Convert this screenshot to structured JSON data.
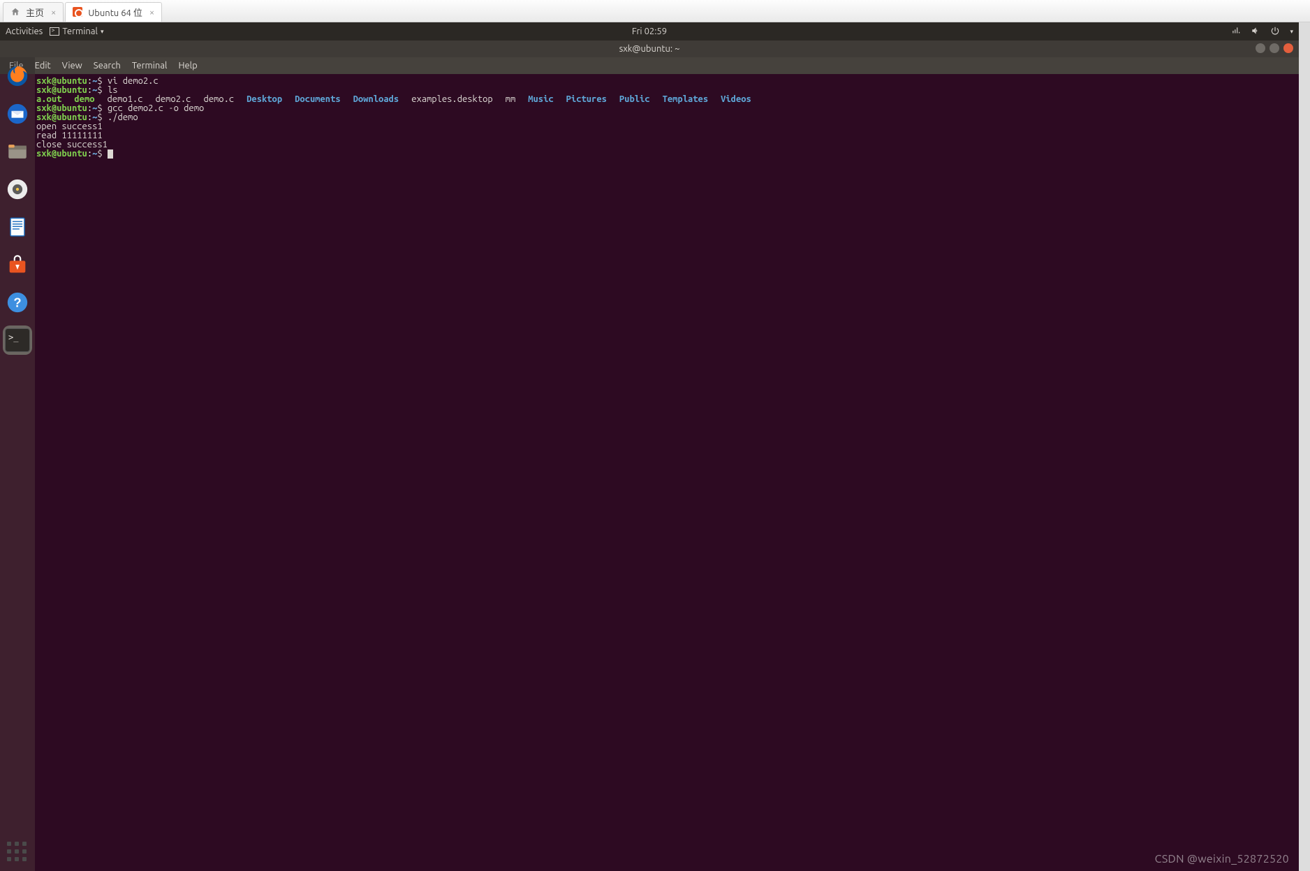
{
  "vm_tabs": {
    "home": "主页",
    "ubuntu": "Ubuntu 64 位"
  },
  "topbar": {
    "activities": "Activities",
    "app_label": "Terminal",
    "clock": "Fri 02:59"
  },
  "window": {
    "title": "sxk@ubuntu: ~"
  },
  "menubar": {
    "file": "File",
    "edit": "Edit",
    "view": "View",
    "search": "Search",
    "terminal": "Terminal",
    "help": "Help"
  },
  "prompt": {
    "user_host": "sxk@ubuntu",
    "sep": ":",
    "path": "~",
    "sym": "$"
  },
  "commands": {
    "c1": "vi demo2.c",
    "c2": "ls",
    "c3": "gcc demo2.c -o demo",
    "c4": "./demo"
  },
  "ls": {
    "a_out": "a.out",
    "demo_dir": "demo",
    "demo1c": "demo1.c",
    "demo2c": "demo2.c",
    "democ": "demo.c",
    "dirs": {
      "desktop": "Desktop",
      "documents": "Documents",
      "downloads": "Downloads",
      "music": "Music",
      "pictures": "Pictures",
      "public": "Public",
      "templates": "Templates",
      "videos": "Videos"
    },
    "examples": "examples.desktop",
    "mm": "mm"
  },
  "program_output": {
    "l1": "open success1",
    "l2": "read 11111111",
    "l3": "close success1"
  },
  "watermark": "CSDN @weixin_52872520"
}
